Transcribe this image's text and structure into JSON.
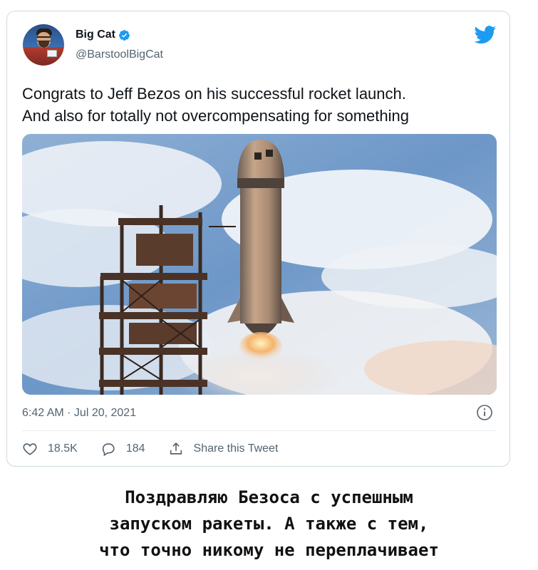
{
  "tweet": {
    "author_name": "Big Cat",
    "handle": "@BarstoolBigCat",
    "text_lines": [
      "Congrats to Jeff Bezos on his successful rocket launch.",
      "And also for totally not overcompensating for something"
    ],
    "timestamp": "6:42 AM · Jul 20, 2021",
    "likes": "18.5K",
    "replies": "184",
    "share_label": "Share this Tweet",
    "brand_color": "#1d9bf0"
  },
  "caption": {
    "lines": [
      "Поздравляю Безоса с успешным",
      "запуском ракеты. А также с тем,",
      "что точно никому не переплачивает"
    ]
  },
  "icons": [
    "verified-badge-icon",
    "twitter-bird-icon",
    "info-icon",
    "heart-icon",
    "reply-icon",
    "share-icon"
  ]
}
